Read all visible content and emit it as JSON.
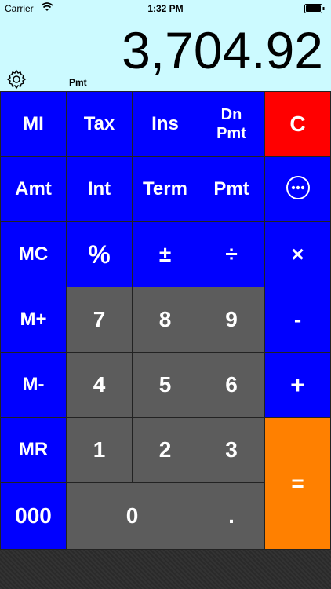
{
  "status": {
    "carrier": "Carrier",
    "time": "1:32 PM"
  },
  "display": {
    "value": "3,704.92",
    "mode": "Pmt"
  },
  "keys": {
    "mi": "MI",
    "tax": "Tax",
    "ins": "Ins",
    "dn_pmt_1": "Dn",
    "dn_pmt_2": "Pmt",
    "clear": "C",
    "amt": "Amt",
    "int": "Int",
    "term": "Term",
    "pmt": "Pmt",
    "mc": "MC",
    "percent": "%",
    "plus_minus": "±",
    "divide": "÷",
    "multiply": "×",
    "mplus": "M+",
    "seven": "7",
    "eight": "8",
    "nine": "9",
    "minus": "-",
    "mminus": "M-",
    "four": "4",
    "five": "5",
    "six": "6",
    "plus": "+",
    "mr": "MR",
    "one": "1",
    "two": "2",
    "three": "3",
    "equals": "=",
    "triple_zero": "000",
    "zero": "0",
    "decimal": "."
  },
  "colors": {
    "blue": "#0000ff",
    "gray": "#5c5c5c",
    "red": "#ff0000",
    "orange": "#ff8000",
    "display_bg": "#ccfaff"
  }
}
